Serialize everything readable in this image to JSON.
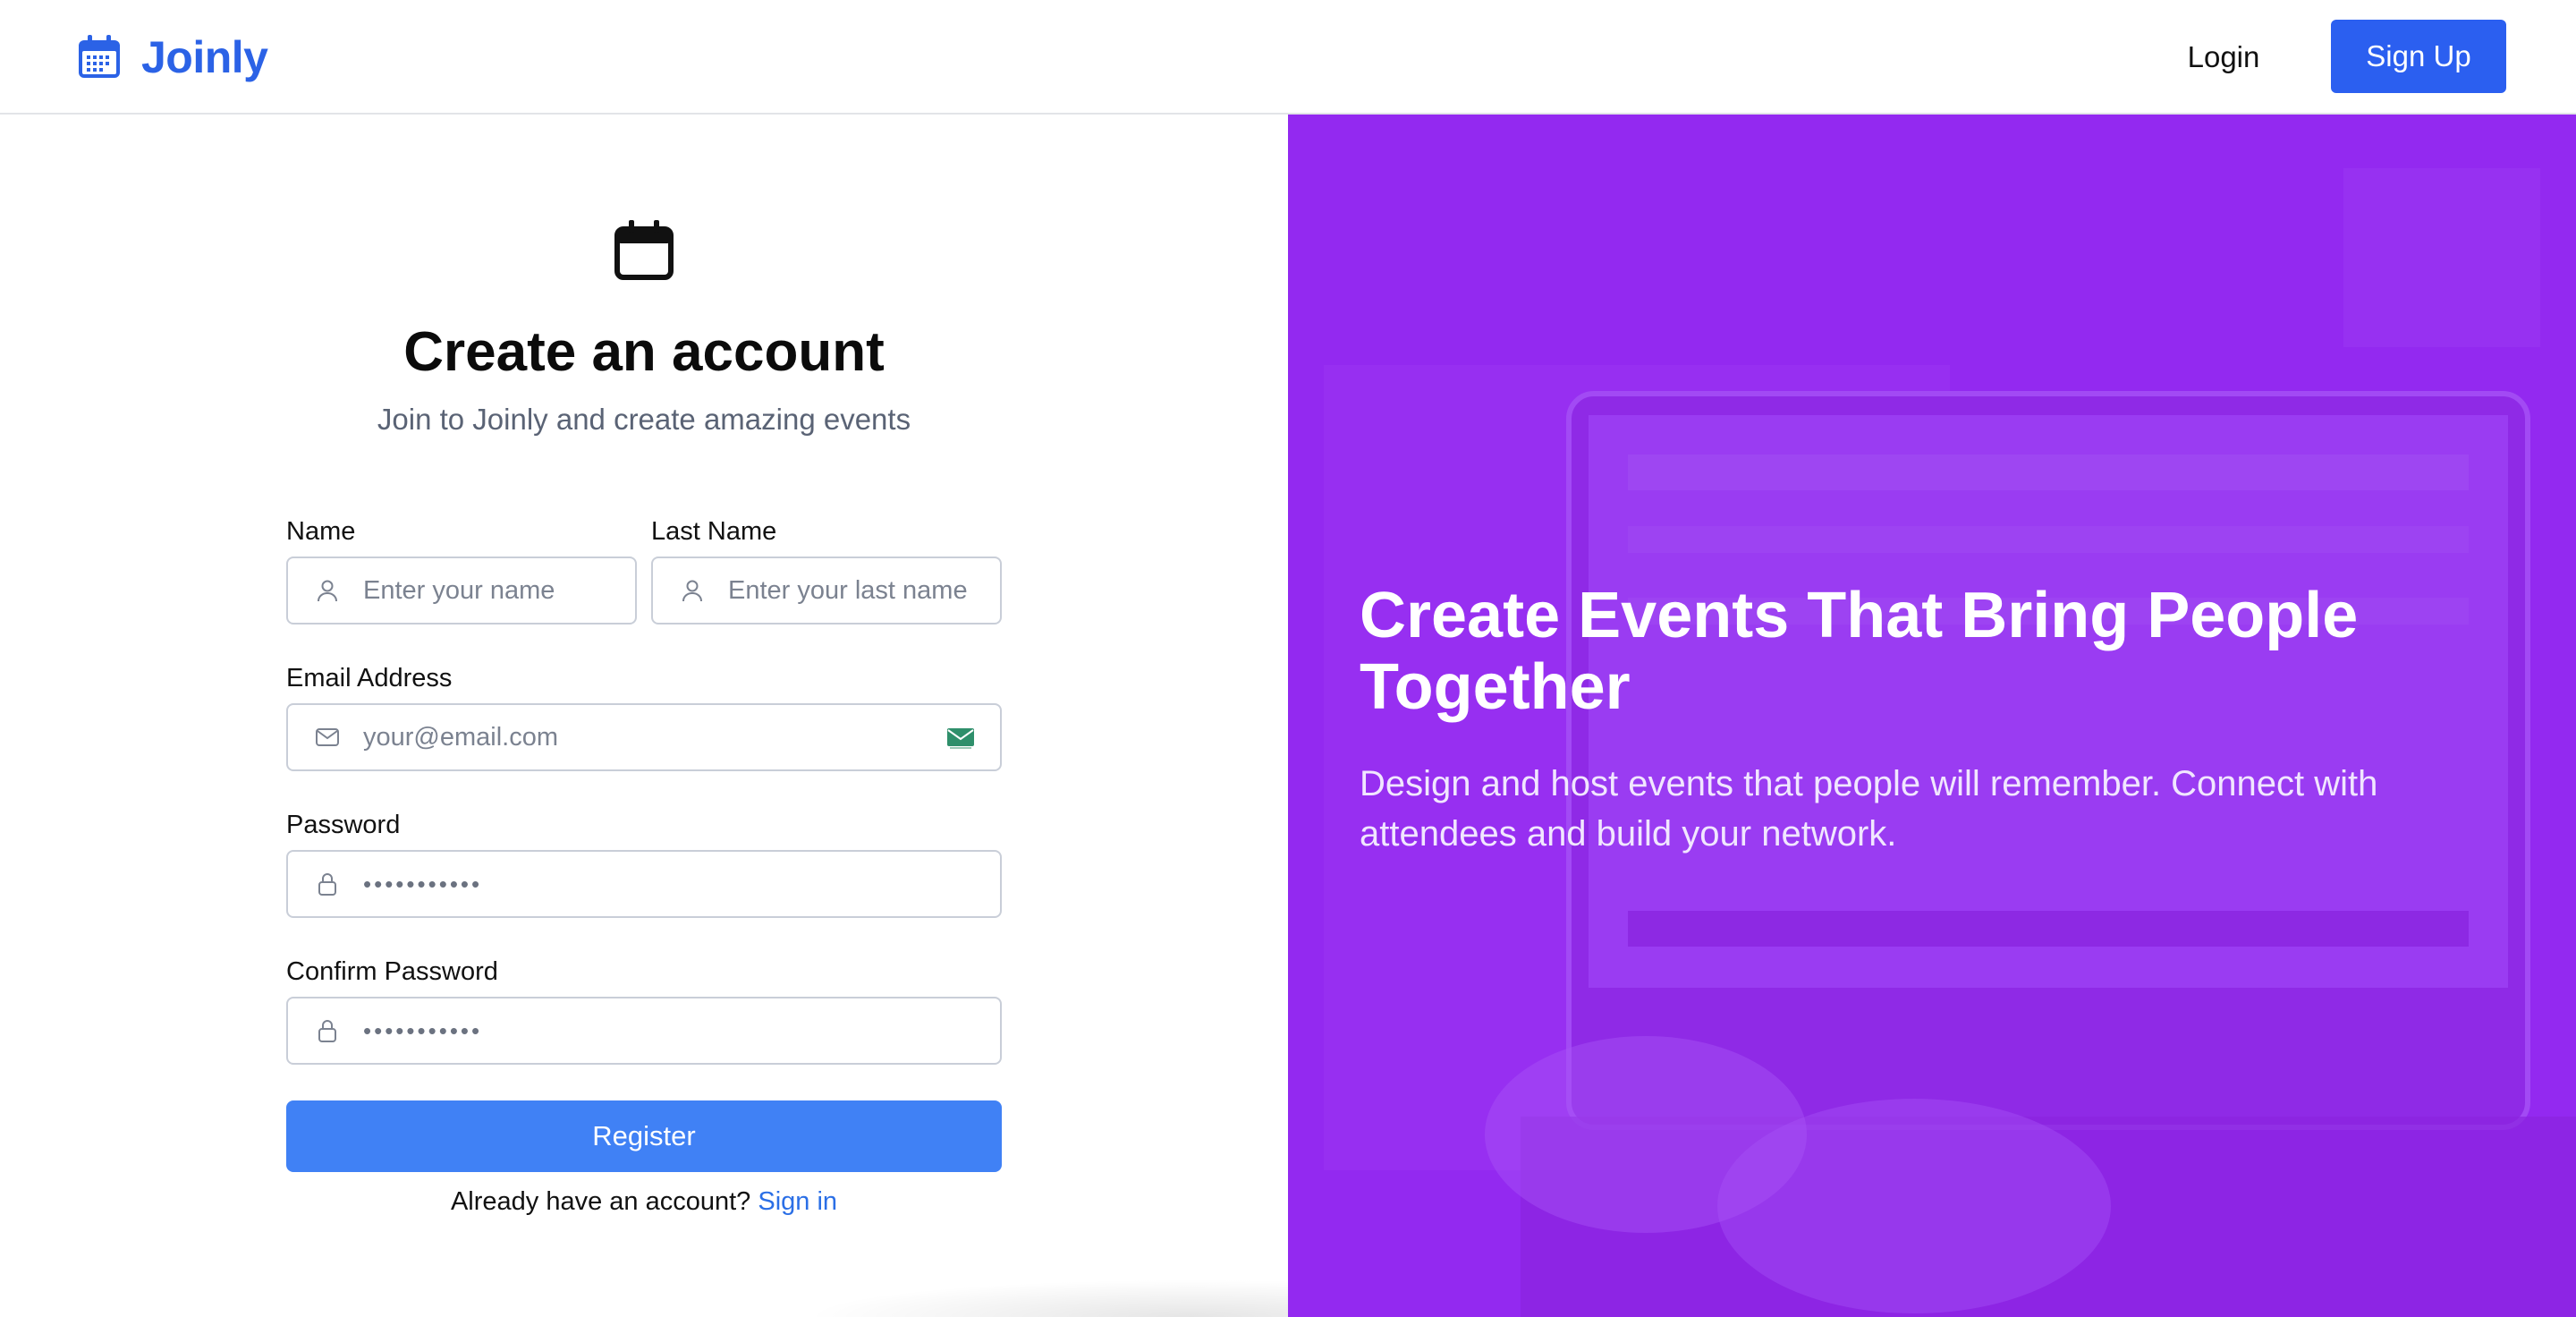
{
  "header": {
    "brand": "Joinly",
    "login_label": "Login",
    "signup_label": "Sign Up"
  },
  "form": {
    "title": "Create an account",
    "subtitle": "Join to Joinly and create amazing events",
    "name_label": "Name",
    "name_placeholder": "Enter your name",
    "lastname_label": "Last Name",
    "lastname_placeholder": "Enter your last name",
    "email_label": "Email Address",
    "email_placeholder": "your@email.com",
    "password_label": "Password",
    "password_value": "•••••••••••",
    "confirm_label": "Confirm Password",
    "confirm_value": "•••••••••••",
    "register_label": "Register",
    "already_text": "Already have an account?",
    "signin_label": "Sign in"
  },
  "hero": {
    "title": "Create Events That Bring People Together",
    "text": "Design and host events that people will remember. Connect with attendees and build your network."
  },
  "colors": {
    "brand_blue": "#2b62e6",
    "primary_button": "#2b5ff0",
    "register_button": "#4081f5",
    "hero_purple": "#9329f0",
    "link_blue": "#2b6fe6"
  },
  "icons": {
    "brand": "calendar-icon",
    "form_header": "calendar-icon",
    "name": "user-icon",
    "lastname": "user-icon",
    "email": "mail-icon",
    "email_badge": "mail-badge-icon",
    "password": "lock-icon",
    "confirm": "lock-icon"
  }
}
